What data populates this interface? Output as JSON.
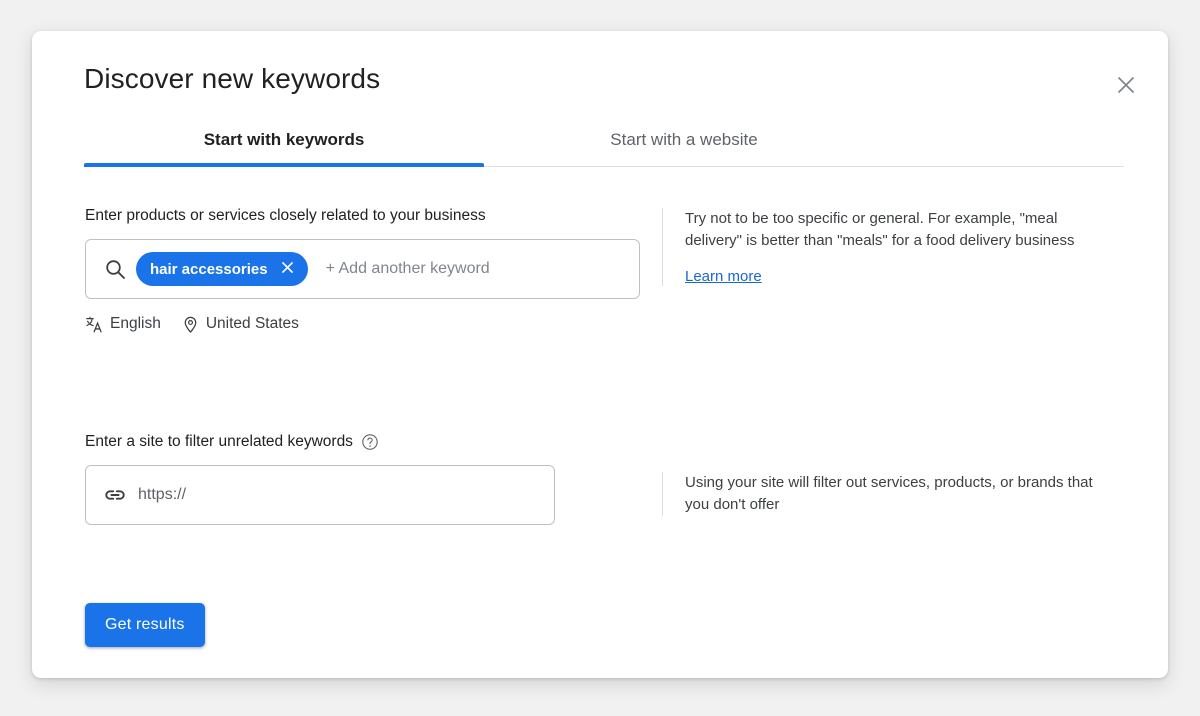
{
  "page": {
    "background_color": "#f1f1f1",
    "accent_color": "#1a73e8",
    "link_color": "#1967d2"
  },
  "dialog": {
    "title": "Discover new keywords",
    "close_label": "Close",
    "close_icon": "close-icon"
  },
  "tabs": [
    {
      "label": "Start with keywords",
      "selected": true
    },
    {
      "label": "Start with a website",
      "selected": false
    }
  ],
  "keyword_section": {
    "label": "Enter products or services closely related to your business",
    "search_icon": "search-icon",
    "chips": [
      {
        "label": "hair accessories",
        "remove_icon": "close-icon"
      }
    ],
    "placeholder": "+ Add another keyword",
    "meta": [
      {
        "icon": "translate-icon",
        "label": "English"
      },
      {
        "icon": "location-pin-icon",
        "label": "United States"
      }
    ],
    "hint": "Try not to be too specific or general. For example, \"meal delivery\" is better than \"meals\" for a food delivery business",
    "hint_link": "Learn more"
  },
  "site_section": {
    "label": "Enter a site to filter unrelated keywords",
    "help_icon": "help-circle-icon",
    "link_icon": "link-icon",
    "placeholder": "https://",
    "value": "",
    "hint": "Using your site will filter out services, products, or brands that you don't offer"
  },
  "footer": {
    "submit_label": "Get results"
  }
}
